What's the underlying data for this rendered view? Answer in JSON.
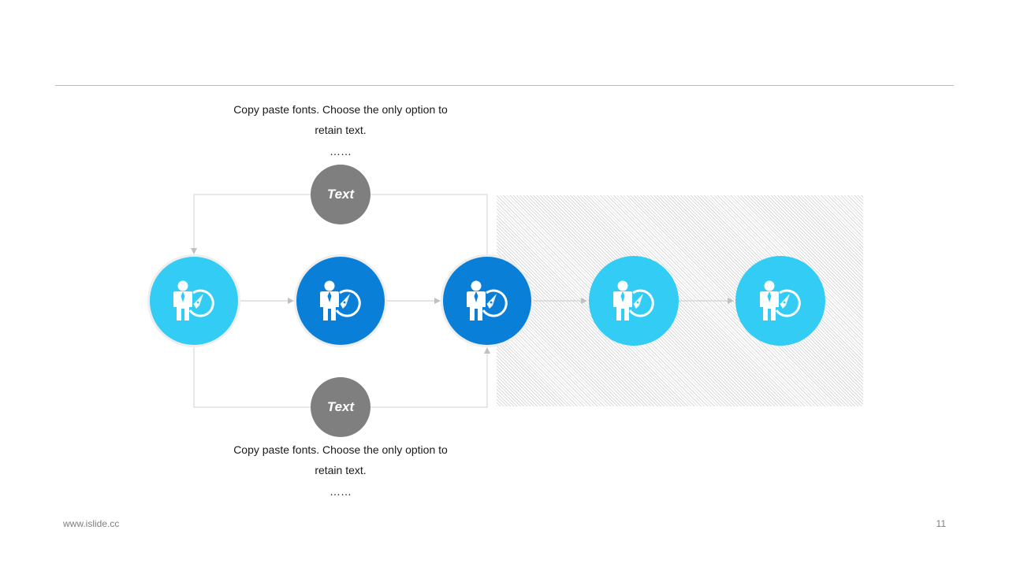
{
  "slide": {
    "top_description": "Copy paste fonts. Choose the only option to retain text.",
    "top_dots": "……",
    "bottom_description": "Copy paste fonts. Choose the only option to retain text.",
    "bottom_dots": "……",
    "top_branch_label": "Text",
    "bottom_branch_label": "Text",
    "footer_url": "www.islide.cc",
    "page_number": "11"
  },
  "colors": {
    "light_blue": "#33ccf5",
    "dark_blue": "#0a7fd8",
    "gray_node": "#7f7f7f",
    "connector": "#c8c8c8"
  },
  "nodes": [
    {
      "icon": "businessman-compass-icon",
      "color": "light_blue"
    },
    {
      "icon": "businessman-compass-icon",
      "color": "dark_blue"
    },
    {
      "icon": "businessman-compass-icon",
      "color": "dark_blue"
    },
    {
      "icon": "businessman-compass-icon",
      "color": "light_blue"
    },
    {
      "icon": "businessman-compass-icon",
      "color": "light_blue"
    }
  ]
}
